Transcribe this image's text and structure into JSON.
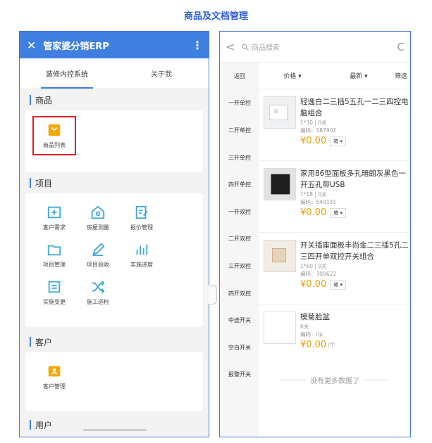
{
  "caption": "商品及文档管理",
  "left": {
    "app_title": "管家婆分销ERP",
    "tabs": [
      "装修内控系统",
      "关于我"
    ],
    "sections": {
      "goods": {
        "title": "商品",
        "items": [
          "商品列表"
        ]
      },
      "project": {
        "title": "项目",
        "items": [
          "客户需求",
          "房屋测量",
          "报价管理",
          "项目管理",
          "项目验收",
          "实施进度",
          "实施变更",
          "施工巡检"
        ]
      },
      "customer": {
        "title": "客户",
        "items": [
          "客户管理"
        ]
      },
      "user": {
        "title": "用户"
      }
    },
    "accent": "#3f7fe0",
    "highlight_color": "#e02020"
  },
  "right": {
    "search_placeholder": "商品搜索",
    "categories": [
      "返回",
      "一开单控",
      "二开单控",
      "三开单控",
      "四开单控",
      "一开双控",
      "二开双控",
      "三开双控",
      "四开双控",
      "中途开关",
      "空白开关",
      "报警开关"
    ],
    "sort": [
      "价格 ▾",
      "最新 ▾",
      "筛选"
    ],
    "products": [
      {
        "name": "轻逸白二三插5五孔一二三四控电脑组合",
        "spec": "1*30 | 0关",
        "code": "编码：187902",
        "price": "¥0.00",
        "unit": "箱 ▾"
      },
      {
        "name": "家用86型面板多孔暗朗灰黑色一开五孔带USB",
        "spec": "1*18 | 0关",
        "code": "编码：540131",
        "price": "¥0.00",
        "unit": "箱 ▾"
      },
      {
        "name": "开关插座面板丰尚金二三插5孔二三四开单双控开关组合",
        "spec": "1*60 | 0关",
        "code": "编码：300622",
        "price": "¥0.00",
        "unit": "箱 ▾"
      },
      {
        "name": "模菊脸盆",
        "spec": "0关",
        "code": "编码：l/p",
        "price": "¥0.00",
        "unit": "/个"
      }
    ],
    "no_more": "没有更多数据了",
    "price_color": "#e8a000"
  }
}
